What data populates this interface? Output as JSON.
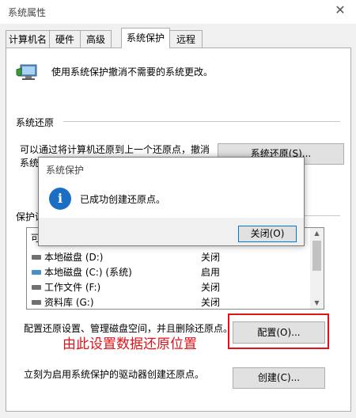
{
  "window": {
    "title": "系统属性",
    "close_symbol": "✕"
  },
  "tabs": [
    {
      "label": "计算机名"
    },
    {
      "label": "硬件"
    },
    {
      "label": "高级"
    },
    {
      "label": "系统保护",
      "active": true
    },
    {
      "label": "远程"
    }
  ],
  "intro": {
    "icon": "computer-shield-icon",
    "text": "使用系统保护撤消不需要的系统更改。"
  },
  "restore": {
    "section_title": "系统还原",
    "description_line1": "可以通过将计算机还原到上一个还原点，撤消",
    "description_line2": "系统",
    "button_label": "系统还原(S)..."
  },
  "protection": {
    "section_title_fragment": "保护设",
    "list_header_fragment": "可",
    "drives": [
      {
        "name": "本地磁盘 (D:)",
        "status": "关闭",
        "icon": "drive-icon"
      },
      {
        "name": "本地磁盘 (C:) (系统)",
        "status": "启用",
        "icon": "system-drive-icon"
      },
      {
        "name": "工作文件 (F:)",
        "status": "关闭",
        "icon": "drive-icon"
      },
      {
        "name": "资料库 (G:)",
        "status": "关闭",
        "icon": "drive-icon"
      }
    ]
  },
  "configure": {
    "text": "配置还原设置、管理磁盘空间，并且删除还原点。",
    "button_label": "配置(O)..."
  },
  "create": {
    "text": "立刻为启用系统保护的驱动器创建还原点。",
    "button_label": "创建(C)..."
  },
  "dialog": {
    "title": "系统保护",
    "message": "已成功创建还原点。",
    "icon": "info-icon",
    "icon_glyph": "i",
    "close_button_label": "关闭(O)"
  },
  "annotation": {
    "text": "由此设置数据还原位置",
    "color": "#e0121a"
  },
  "colors": {
    "accent": "#0078d7",
    "info_icon": "#1a6ec4"
  }
}
